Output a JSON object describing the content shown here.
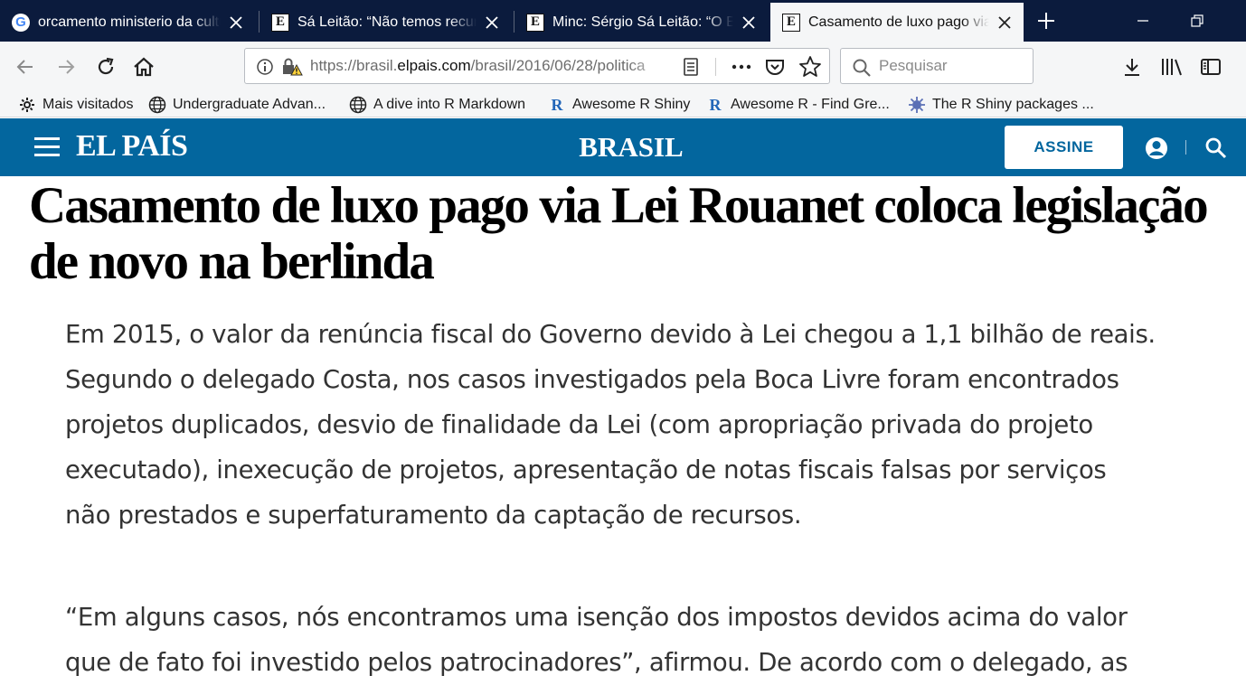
{
  "browser": {
    "tabs": [
      {
        "favicon": "google-icon",
        "title": "orcamento ministerio da cultura - Pesquisa Google",
        "active": false
      },
      {
        "favicon": "elpais-icon",
        "title": "Sá Leitão: “Não temos recursos”",
        "active": false
      },
      {
        "favicon": "elpais-icon",
        "title": "Minc: Sérgio Sá Leitão: “O Brasil",
        "active": false
      },
      {
        "favicon": "elpais-icon",
        "title": "Casamento de luxo pago via Lei Rouanet",
        "active": true
      }
    ],
    "url": {
      "prefix": "https://brasil.",
      "domain": "elpais.com",
      "path": "/brasil/2016/06/28/politica"
    },
    "search_placeholder": "Pesquisar",
    "bookmarks": [
      {
        "icon": "gear-icon",
        "label": "Mais visitados"
      },
      {
        "icon": "globe-icon",
        "label": "Undergraduate Advan..."
      },
      {
        "icon": "globe-icon",
        "label": "A dive into R Markdown"
      },
      {
        "icon": "r-logo-icon",
        "label": "Awesome R Shiny"
      },
      {
        "icon": "r-logo-icon",
        "label": "Awesome R - Find Gre..."
      },
      {
        "icon": "virus-icon",
        "label": "The R Shiny packages ..."
      }
    ]
  },
  "site": {
    "logo": "EL PAÍS",
    "section": "BRASIL",
    "subscribe_label": "ASSINE",
    "brand_color": "#03669e"
  },
  "article": {
    "headline": "Casamento de luxo pago via Lei Rouanet coloca legislação de novo na berlinda",
    "paragraphs": [
      {
        "lines": [
          "Em 2015, o valor da renúncia fiscal do Governo devido à Lei chegou a 1,1 bilhão de reais.",
          "Segundo o delegado Costa, nos casos investigados pela Boca Livre foram encontrados",
          "projetos duplicados, desvio de finalidade da Lei (com apropriação privada do projeto",
          "executado), inexecução de projetos, apresentação de notas fiscais falsas por serviços",
          "não prestados e superfaturamento da captação de recursos."
        ]
      },
      {
        "lines": [
          "“Em alguns casos, nós encontramos uma isenção dos impostos devidos acima do valor",
          "que de fato foi investido pelos patrocinadores”, afirmou. De acordo com o delegado, as"
        ]
      }
    ]
  }
}
